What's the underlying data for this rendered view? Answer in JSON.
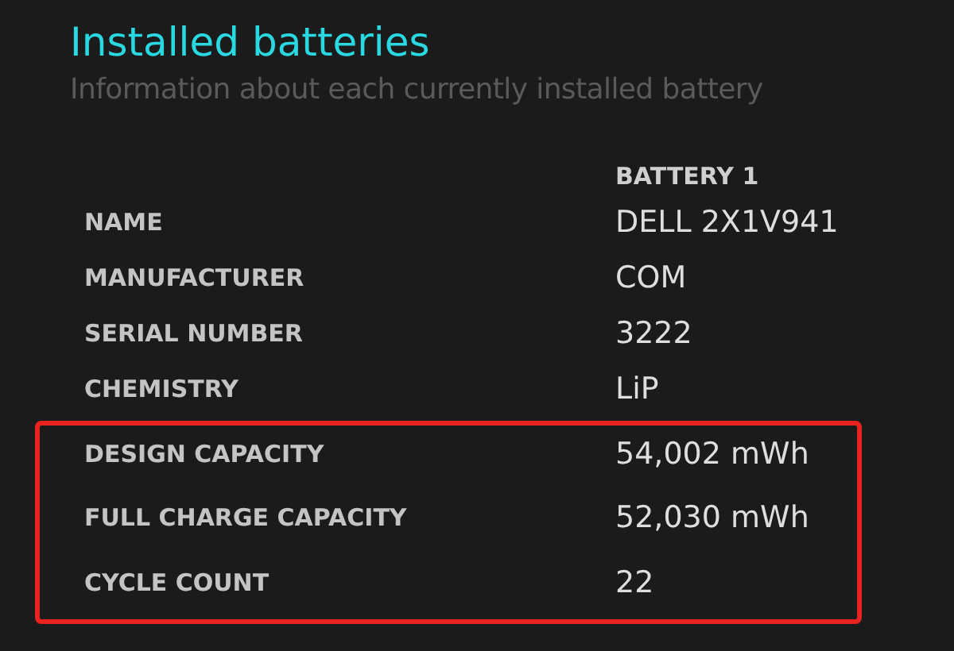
{
  "title": "Installed batteries",
  "subtitle": "Information about each currently installed battery",
  "column_header": "BATTERY 1",
  "rows": [
    {
      "label": "NAME",
      "value": "DELL 2X1V941",
      "highlighted": false
    },
    {
      "label": "MANUFACTURER",
      "value": "COM",
      "highlighted": false
    },
    {
      "label": "SERIAL NUMBER",
      "value": "3222",
      "highlighted": false
    },
    {
      "label": "CHEMISTRY",
      "value": "LiP",
      "highlighted": false
    },
    {
      "label": "DESIGN CAPACITY",
      "value": "54,002 mWh",
      "highlighted": true
    },
    {
      "label": "FULL CHARGE CAPACITY",
      "value": "52,030 mWh",
      "highlighted": true
    },
    {
      "label": "CYCLE COUNT",
      "value": "22",
      "highlighted": true
    }
  ]
}
